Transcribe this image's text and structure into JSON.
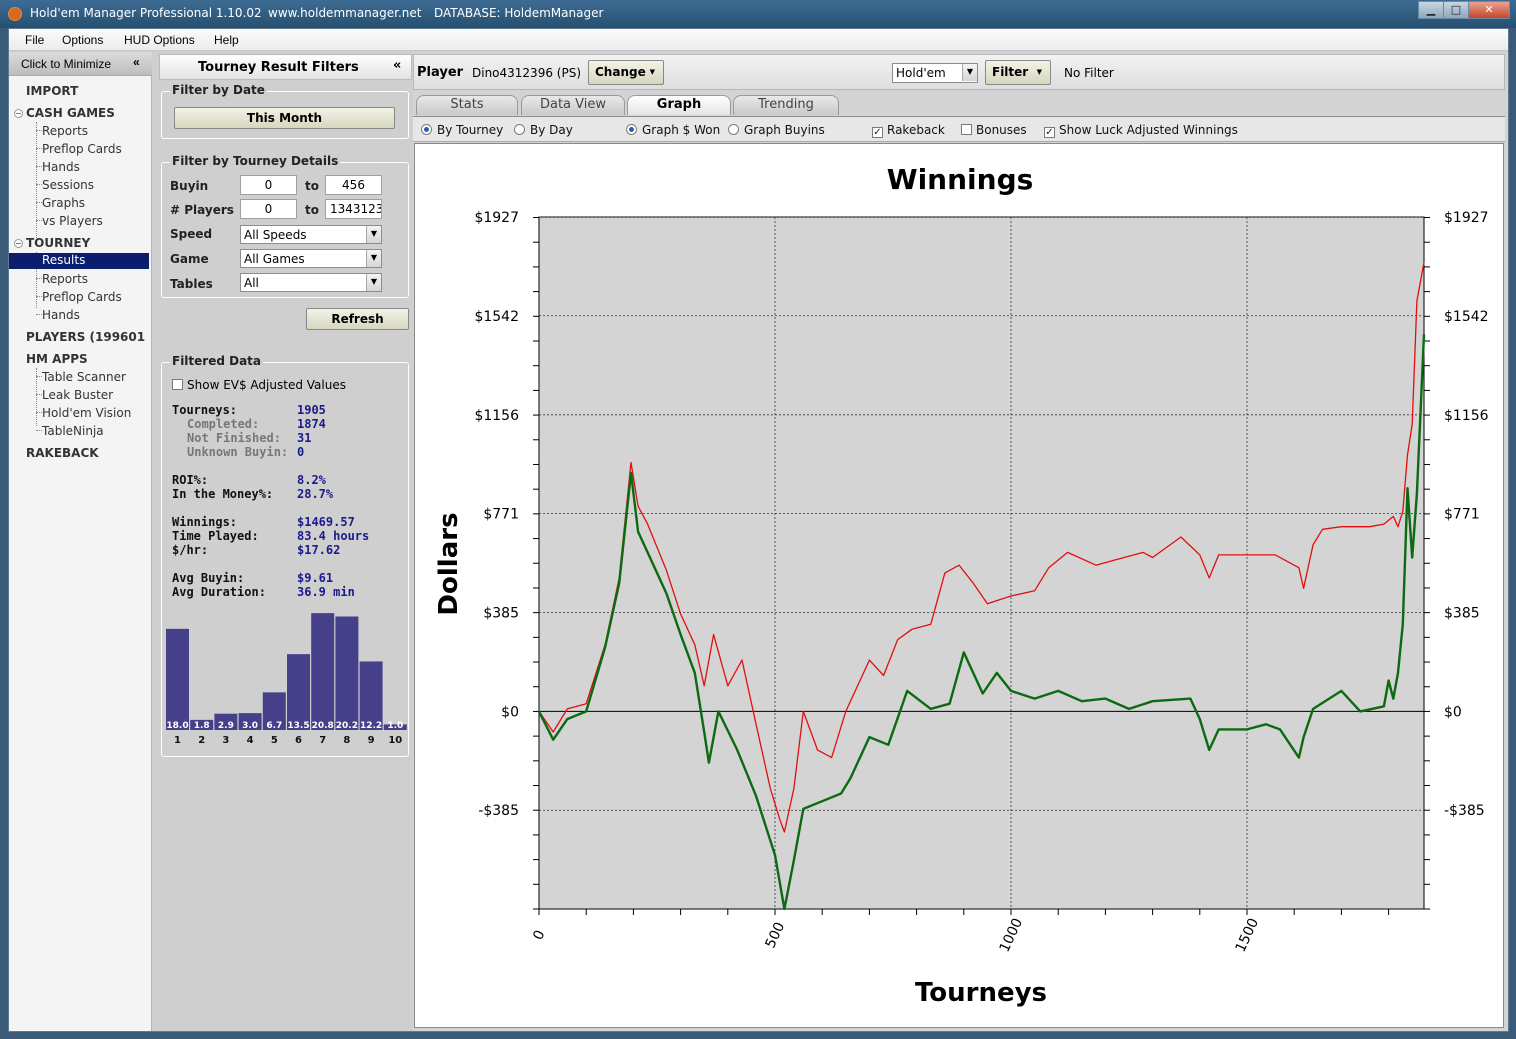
{
  "window": {
    "title": "Hold'em Manager Professional 1.10.02",
    "url": "www.holdemmanager.net",
    "database": "DATABASE: HoldemManager",
    "minimize": "▁",
    "maximize": "□",
    "close": "✕"
  },
  "menu": [
    "File",
    "Options",
    "HUD Options",
    "Help"
  ],
  "nav": {
    "minimize_label": "Click to Minimize",
    "minimize_icon": "«",
    "import": "IMPORT",
    "cash_games": "CASH GAMES",
    "cash_items": [
      "Reports",
      "Preflop Cards",
      "Hands",
      "Sessions",
      "Graphs",
      "vs Players"
    ],
    "tourney": "TOURNEY",
    "tourney_items": [
      "Results",
      "Reports",
      "Preflop Cards",
      "Hands"
    ],
    "players": "PLAYERS (199601",
    "hm_apps": "HM APPS",
    "app_items": [
      "Table Scanner",
      "Leak Buster",
      "Hold'em Vision",
      "TableNinja"
    ],
    "rakeback": "RAKEBACK"
  },
  "filters": {
    "title": "Tourney Result Filters",
    "collapse_icon": "«",
    "by_date": {
      "title": "Filter by Date",
      "button": "This Month"
    },
    "details": {
      "title": "Filter by Tourney Details",
      "buyin_label": "Buyin",
      "buyin_from": "0",
      "to1": "to",
      "buyin_to": "456",
      "players_label": "# Players",
      "players_from": "0",
      "to2": "to",
      "players_to": "1343123",
      "speed_label": "Speed",
      "speed_value": "All Speeds",
      "game_label": "Game",
      "game_value": "All Games",
      "tables_label": "Tables",
      "tables_value": "All"
    },
    "refresh": "Refresh",
    "filtered_data": {
      "title": "Filtered Data",
      "ev_checkbox": "Show EV$ Adjusted Values",
      "stats": [
        {
          "label": "Tourneys:",
          "value": "1905",
          "sub": false
        },
        {
          "label": "Completed:",
          "value": "1874",
          "sub": true
        },
        {
          "label": "Not Finished:",
          "value": "31",
          "sub": true
        },
        {
          "label": "Unknown Buyin:",
          "value": "0",
          "sub": true
        },
        {
          "label": "ROI%:",
          "value": "8.2%",
          "sub": false
        },
        {
          "label": "In the Money%:",
          "value": "28.7%",
          "sub": false
        },
        {
          "label": "Winnings:",
          "value": "$1469.57",
          "sub": false
        },
        {
          "label": "Time Played:",
          "value": "83.4 hours",
          "sub": false
        },
        {
          "label": "$/hr:",
          "value": "$17.62",
          "sub": false
        },
        {
          "label": "Avg Buyin:",
          "value": "$9.61",
          "sub": false
        },
        {
          "label": "Avg Duration:",
          "value": "36.9 min",
          "sub": false
        }
      ],
      "histogram": {
        "bins": [
          "1",
          "2",
          "3",
          "4",
          "5",
          "6",
          "7",
          "8",
          "9",
          "10"
        ],
        "values": [
          "18.0",
          "1.8",
          "2.9",
          "3.0",
          "6.7",
          "13.5",
          "20.8",
          "20.2",
          "12.2",
          "1.0"
        ],
        "numeric": [
          18.0,
          1.8,
          2.9,
          3.0,
          6.7,
          13.5,
          20.8,
          20.2,
          12.2,
          1.0
        ],
        "bar_color": "#46408a"
      }
    }
  },
  "main": {
    "player_label": "Player",
    "player_name": "Dino4312396 (PS)",
    "change_button": "Change",
    "game_select": "Hold'em",
    "filter_button": "Filter",
    "filter_status": "No Filter",
    "tabs": [
      "Stats",
      "Data View",
      "Graph",
      "Trending"
    ],
    "active_tab": "Graph",
    "options": {
      "by_tourney": "By Tourney",
      "by_day": "By Day",
      "graph_won": "Graph $ Won",
      "graph_buyins": "Graph Buyins",
      "rakeback": "Rakeback",
      "bonuses": "Bonuses",
      "luck": "Show Luck Adjusted Winnings"
    }
  },
  "chart_data": {
    "type": "line",
    "title": "Winnings",
    "xlabel": "Tourneys",
    "ylabel": "Dollars",
    "x_ticks": [
      "0",
      "500",
      "1000",
      "1500"
    ],
    "y_ticks": [
      "$1927",
      "$1542",
      "$1156",
      "$771",
      "$385",
      "$0",
      "-$385"
    ],
    "xlim": [
      0,
      1875
    ],
    "ylim": [
      -770,
      1927
    ],
    "grid": true,
    "background": "#d4d4d4",
    "series": [
      {
        "color": "#e01010",
        "x": [
          0,
          30,
          60,
          100,
          140,
          170,
          195,
          210,
          230,
          270,
          300,
          330,
          350,
          370,
          400,
          430,
          460,
          490,
          510,
          520,
          540,
          560,
          590,
          620,
          650,
          680,
          700,
          730,
          760,
          790,
          830,
          860,
          890,
          920,
          950,
          1000,
          1050,
          1080,
          1120,
          1180,
          1220,
          1280,
          1300,
          1360,
          1400,
          1420,
          1440,
          1500,
          1560,
          1610,
          1620,
          1640,
          1660,
          1700,
          1760,
          1790,
          1810,
          1820,
          1830,
          1840,
          1850,
          1860,
          1875
        ],
        "y": [
          0,
          -80,
          10,
          30,
          260,
          520,
          970,
          800,
          730,
          550,
          380,
          260,
          100,
          300,
          100,
          200,
          -50,
          -300,
          -420,
          -470,
          -300,
          0,
          -150,
          -180,
          0,
          120,
          200,
          140,
          280,
          320,
          340,
          540,
          570,
          500,
          420,
          450,
          470,
          560,
          620,
          570,
          590,
          620,
          600,
          680,
          610,
          520,
          610,
          610,
          610,
          560,
          480,
          650,
          710,
          720,
          720,
          730,
          760,
          720,
          780,
          1000,
          1120,
          1600,
          1750
        ]
      },
      {
        "color": "#0c6a12",
        "x": [
          0,
          30,
          60,
          100,
          140,
          170,
          195,
          210,
          230,
          270,
          300,
          330,
          350,
          360,
          380,
          420,
          460,
          500,
          520,
          540,
          560,
          600,
          640,
          660,
          700,
          740,
          780,
          830,
          870,
          900,
          940,
          970,
          1000,
          1050,
          1100,
          1150,
          1200,
          1250,
          1300,
          1380,
          1400,
          1420,
          1440,
          1500,
          1540,
          1570,
          1610,
          1620,
          1640,
          1700,
          1740,
          1790,
          1800,
          1810,
          1820,
          1830,
          1840,
          1850,
          1860,
          1875
        ],
        "y": [
          0,
          -110,
          -30,
          0,
          250,
          500,
          930,
          700,
          620,
          460,
          300,
          150,
          -80,
          -200,
          0,
          -150,
          -330,
          -560,
          -770,
          -580,
          -380,
          -350,
          -320,
          -260,
          -100,
          -130,
          80,
          10,
          30,
          230,
          70,
          150,
          80,
          50,
          80,
          40,
          50,
          10,
          40,
          50,
          -30,
          -150,
          -70,
          -70,
          -50,
          -70,
          -180,
          -100,
          10,
          80,
          0,
          20,
          120,
          50,
          150,
          340,
          870,
          600,
          850,
          1470
        ]
      }
    ]
  }
}
